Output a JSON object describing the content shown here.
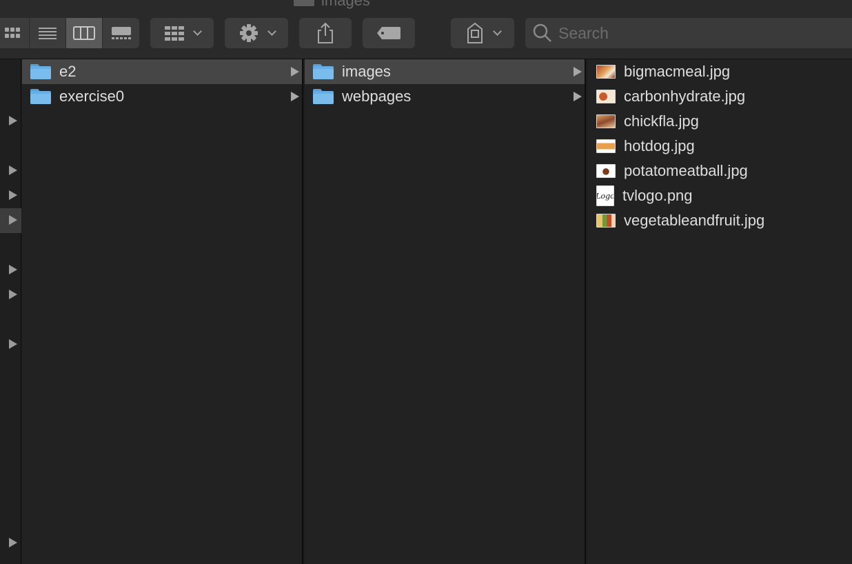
{
  "window": {
    "title": "images"
  },
  "toolbar": {
    "search_placeholder": "Search",
    "view_buttons": [
      "icon-view",
      "list-view",
      "column-view",
      "gallery-view"
    ],
    "active_view": "column-view"
  },
  "columns": {
    "col1": {
      "items": [
        {
          "label": "e2",
          "selected": true
        },
        {
          "label": "exercise0",
          "selected": false
        }
      ]
    },
    "col2": {
      "items": [
        {
          "label": "images",
          "selected": true
        },
        {
          "label": "webpages",
          "selected": false
        }
      ]
    },
    "col3": {
      "items": [
        {
          "label": "bigmacmeal.jpg"
        },
        {
          "label": "carbonhydrate.jpg"
        },
        {
          "label": "chickfla.jpg"
        },
        {
          "label": "hotdog.jpg"
        },
        {
          "label": "potatomeatball.jpg"
        },
        {
          "label": "tvlogo.png",
          "thumb_text": "Logo"
        },
        {
          "label": "vegetableandfruit.jpg"
        }
      ]
    }
  },
  "colors": {
    "folder": "#67aee4",
    "selection": "#464646",
    "background": "#222222"
  }
}
